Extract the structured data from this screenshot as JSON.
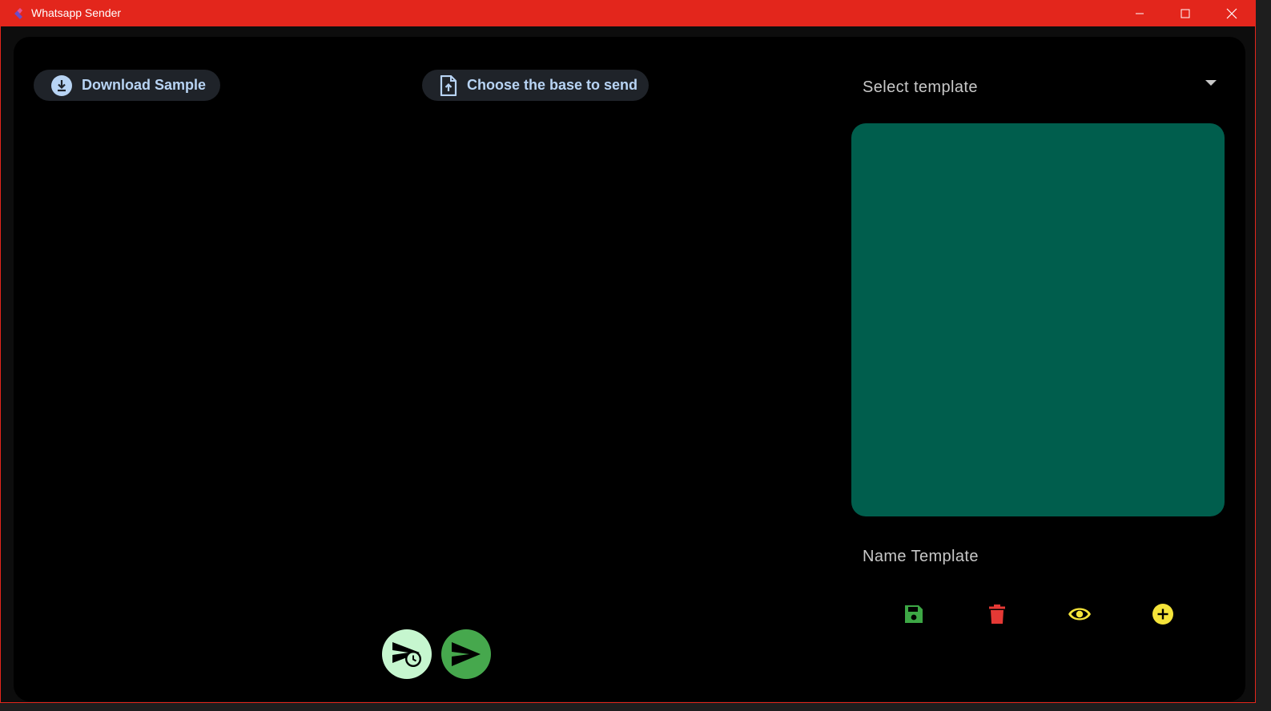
{
  "window": {
    "title": "Whatsapp Sender",
    "accent_color": "#e3261c",
    "controls": {
      "minimize_icon": "minimize-icon",
      "maximize_icon": "maximize-icon",
      "close_icon": "close-icon"
    }
  },
  "toolbar": {
    "download_sample_label": "Download Sample",
    "download_sample_icon": "download-circle-icon",
    "choose_base_label": "Choose the base to send",
    "choose_base_icon": "file-upload-icon"
  },
  "template_panel": {
    "select_template_placeholder": "Select template",
    "editor_color": "#005e4d",
    "name_template_placeholder": "Name Template",
    "actions": [
      {
        "name": "save",
        "icon": "save-icon",
        "color": "#3da745"
      },
      {
        "name": "delete",
        "icon": "delete-icon",
        "color": "#e53935"
      },
      {
        "name": "preview",
        "icon": "eye-icon",
        "color": "#f5e43a"
      },
      {
        "name": "add",
        "icon": "add-circle-icon",
        "color": "#f5e43a"
      }
    ]
  },
  "send_actions": {
    "schedule_send_icon": "schedule-send-icon",
    "schedule_send_color": "#c6f6cf",
    "send_icon": "send-icon",
    "send_color": "#46a84d"
  }
}
